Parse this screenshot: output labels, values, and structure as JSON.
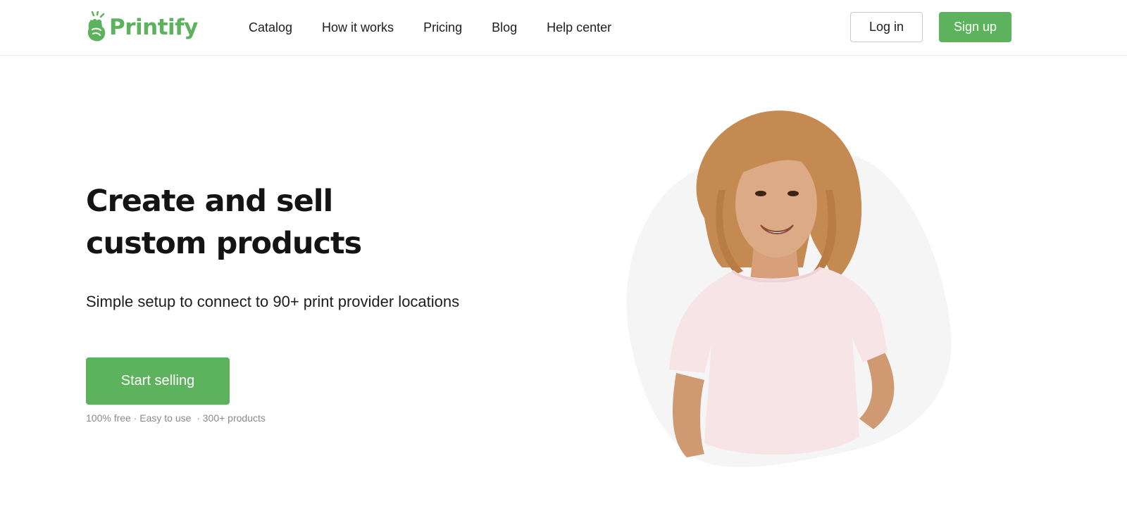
{
  "brand": {
    "name": "Printify",
    "color": "#5cb25d"
  },
  "nav": {
    "items": [
      {
        "label": "Catalog"
      },
      {
        "label": "How it works"
      },
      {
        "label": "Pricing"
      },
      {
        "label": "Blog"
      },
      {
        "label": "Help center"
      }
    ]
  },
  "header": {
    "login_label": "Log in",
    "signup_label": "Sign up"
  },
  "hero": {
    "title_line1": "Create and sell",
    "title_line2": "custom products",
    "subtitle": "Simple setup to connect to 90+ print provider locations",
    "cta_label": "Start selling",
    "features": "100% free · Easy to use  · 300+ products"
  },
  "colors": {
    "accent": "#5cb25d",
    "text": "#1d1d1f",
    "muted": "#8a8a8a"
  },
  "icons": {
    "logo": "printify-hand-icon",
    "hero": "woman-in-tshirt-photo"
  }
}
